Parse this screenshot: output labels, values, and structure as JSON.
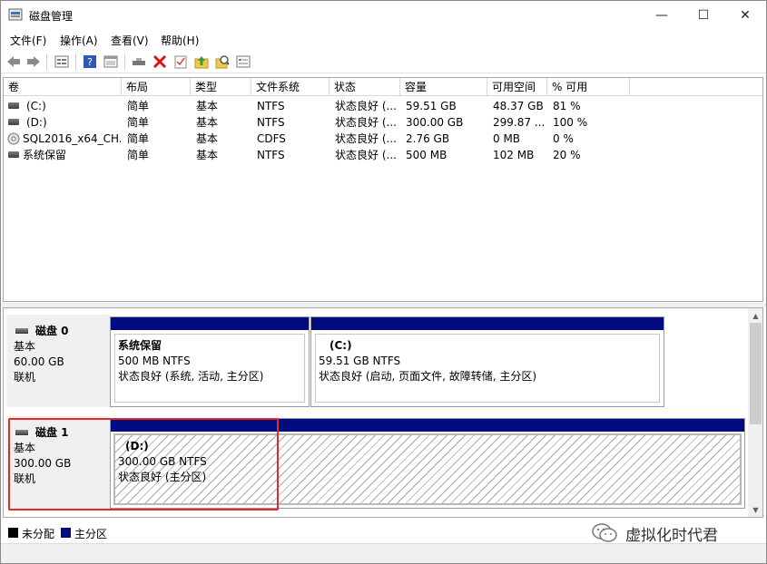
{
  "window": {
    "title": "磁盘管理",
    "controls": {
      "minimize": "—",
      "maximize": "☐",
      "close": "✕"
    }
  },
  "menubar": {
    "items": [
      "文件(F)",
      "操作(A)",
      "查看(V)",
      "帮助(H)"
    ]
  },
  "toolbar": {
    "icons": [
      "back-arrow-icon",
      "forward-arrow-icon",
      "properties-list-icon",
      "help-icon",
      "view-icon",
      "connect-disk-icon",
      "delete-icon",
      "check-icon",
      "up-folder-icon",
      "search-icon",
      "console-icon"
    ]
  },
  "volume_list": {
    "columns": [
      "卷",
      "布局",
      "类型",
      "文件系统",
      "状态",
      "容量",
      "可用空间",
      "% 可用"
    ],
    "rows": [
      {
        "icon": "volume-icon",
        "volume": "(C:)",
        "layout": "简单",
        "type": "基本",
        "fs": "NTFS",
        "status": "状态良好 (...",
        "capacity": "59.51 GB",
        "free": "48.37 GB",
        "pct": "81 %"
      },
      {
        "icon": "volume-icon",
        "volume": "(D:)",
        "layout": "简单",
        "type": "基本",
        "fs": "NTFS",
        "status": "状态良好 (...",
        "capacity": "300.00 GB",
        "free": "299.87 ...",
        "pct": "100 %"
      },
      {
        "icon": "cd-rom-icon",
        "volume": "SQL2016_x64_CH...",
        "layout": "简单",
        "type": "基本",
        "fs": "CDFS",
        "status": "状态良好 (...",
        "capacity": "2.76 GB",
        "free": "0 MB",
        "pct": "0 %"
      },
      {
        "icon": "volume-icon",
        "volume": "系统保留",
        "layout": "简单",
        "type": "基本",
        "fs": "NTFS",
        "status": "状态良好 (...",
        "capacity": "500 MB",
        "free": "102 MB",
        "pct": "20 %"
      }
    ]
  },
  "disks": [
    {
      "name": "磁盘 0",
      "type": "基本",
      "size": "60.00 GB",
      "state": "联机",
      "partitions": [
        {
          "name": "系统保留",
          "size": "500 MB NTFS",
          "status": "状态良好 (系统, 活动, 主分区)"
        },
        {
          "name": "(C:)",
          "size": "59.51 GB NTFS",
          "status": "状态良好 (启动, 页面文件, 故障转储, 主分区)"
        }
      ]
    },
    {
      "name": "磁盘 1",
      "type": "基本",
      "size": "300.00 GB",
      "state": "联机",
      "partitions": [
        {
          "name": "(D:)",
          "size": "300.00 GB NTFS",
          "status": "状态良好 (主分区)"
        }
      ]
    }
  ],
  "legend": {
    "items": [
      {
        "label": "未分配",
        "color": "#000000"
      },
      {
        "label": "主分区",
        "color": "#000c80"
      }
    ]
  },
  "watermark": {
    "text": "虚拟化时代君"
  },
  "colors": {
    "primary_partition": "#000c80",
    "highlight_box": "#e22a2a"
  }
}
